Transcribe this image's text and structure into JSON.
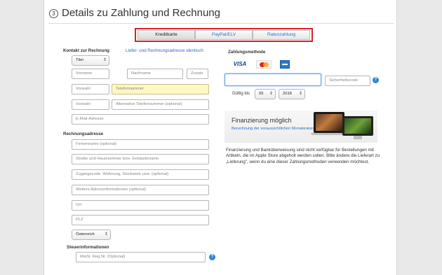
{
  "header": {
    "step_number": "3",
    "title": "Details zu Zahlung und Rechnung"
  },
  "tabs": [
    {
      "label": "Kreditkarte",
      "active": true
    },
    {
      "label": "PayPal/ELV",
      "active": false
    },
    {
      "label": "Ratenzahlung",
      "active": false
    }
  ],
  "contact": {
    "heading": "Kontakt zur Rechnung",
    "same_address_link": "Liefer- und Rechnungsadresse identisch",
    "salutation": "Titel",
    "first_name_placeholder": "Vorname",
    "last_name_placeholder": "Nachname",
    "suffix_placeholder": "Zusatz",
    "area_code1_placeholder": "Vorwahl",
    "phone_placeholder": "Telefonnummer",
    "area_code2_placeholder": "Vorwahl",
    "alt_phone_placeholder": "Alternative Telefonnummer (optional)",
    "email_placeholder": "E-Mail-Adresse"
  },
  "billing": {
    "heading": "Rechnungsadresse",
    "company_placeholder": "Firmenname (optional)",
    "street_placeholder": "Straße und Hausnummer bzw. Gebäudename",
    "access_placeholder": "Zugangscode, Wohnung, Stockwerk usw. (optional)",
    "extra_placeholder": "Weitere Adressinformationen (optional)",
    "city_placeholder": "Ort",
    "zip_placeholder": "PLZ",
    "country": "Österreich"
  },
  "tax": {
    "heading": "Steuerinformationen",
    "vat_placeholder": "MwSt. Reg.Nr. (Optional)"
  },
  "payment": {
    "heading": "Zahlungsmethode",
    "cards": [
      {
        "name": "VISA",
        "icon": "visa-icon"
      },
      {
        "name": "",
        "icon": "mastercard-icon"
      },
      {
        "name": "",
        "icon": "amex-icon"
      }
    ],
    "card_number_value": "",
    "security_code_placeholder": "Sicherheitscode",
    "valid_until_label": "Gültig bis",
    "month": "05",
    "year": "2018"
  },
  "financing": {
    "title": "Finanzierung möglich",
    "link": "Berechnung der voraussichtlichen Monatsraten »",
    "info_text": "Finanzierung und Banküberweisung sind nicht verfügbar für Bestellungen mit Artikeln, die im Apple Store abgeholt werden sollen. Bitte ändere die Lieferart zu „Lieferung\", wenn du eine dieser Zahlungsmethoden verwenden möchtest."
  },
  "colors": {
    "accent": "#2a6fc9",
    "highlight_border": "#d2232a",
    "phone_field_bg": "#fdf7c3"
  }
}
